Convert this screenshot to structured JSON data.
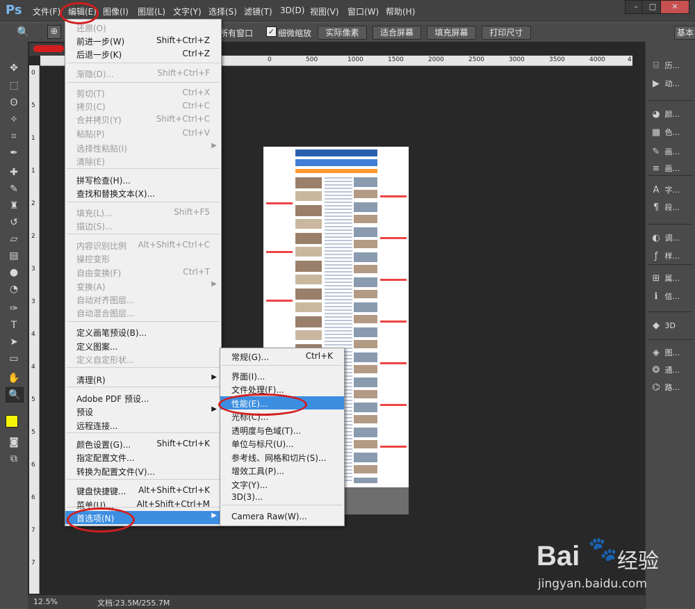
{
  "app": {
    "logo": "Ps"
  },
  "menubar": [
    {
      "label": "文件(F)"
    },
    {
      "label": "编辑(E)"
    },
    {
      "label": "图像(I)"
    },
    {
      "label": "图层(L)"
    },
    {
      "label": "文字(Y)"
    },
    {
      "label": "选择(S)"
    },
    {
      "label": "滤镜(T)"
    },
    {
      "label": "3D(D)"
    },
    {
      "label": "视图(V)"
    },
    {
      "label": "窗口(W)"
    },
    {
      "label": "帮助(H)"
    }
  ],
  "window": {
    "minimize": "–",
    "maximize": "□",
    "close": "✕"
  },
  "options": {
    "all_windows": "所有窗口",
    "scrubby": "细微缩放",
    "actual_pixels": "实际像素",
    "fit_screen": "适合屏幕",
    "fill_screen": "填充屏幕",
    "print_size": "打印尺寸",
    "workspace": "基本",
    "check": "✓"
  },
  "ruler": {
    "h": [
      "0",
      "500",
      "1000",
      "1500",
      "2000",
      "2500",
      "3000",
      "3500",
      "4000",
      "4"
    ],
    "v": [
      "0",
      "5",
      "1",
      "1",
      "2",
      "2",
      "3",
      "3",
      "4",
      "4",
      "5",
      "5",
      "6",
      "6",
      "7",
      "7"
    ]
  },
  "status": {
    "zoom": "12.5%",
    "doc": "文档:23.5M/255.7M"
  },
  "panels": [
    {
      "icon": "history-icon",
      "glyph": "⌸",
      "label": "历..."
    },
    {
      "icon": "actions-icon",
      "glyph": "▶",
      "label": "动..."
    },
    {
      "icon": "color-icon",
      "glyph": "◕",
      "label": "颜..."
    },
    {
      "icon": "swatches-icon",
      "glyph": "▦",
      "label": "色..."
    },
    {
      "icon": "brush-icon",
      "glyph": "✎",
      "label": "画..."
    },
    {
      "icon": "brush-presets-icon",
      "glyph": "≡",
      "label": "画..."
    },
    {
      "icon": "character-icon",
      "glyph": "A",
      "label": "字..."
    },
    {
      "icon": "paragraph-icon",
      "glyph": "¶",
      "label": "段..."
    },
    {
      "icon": "adjustments-icon",
      "glyph": "◐",
      "label": "调..."
    },
    {
      "icon": "styles-icon",
      "glyph": "ƒ",
      "label": "样..."
    },
    {
      "icon": "properties-icon",
      "glyph": "⊞",
      "label": "属..."
    },
    {
      "icon": "info-icon",
      "glyph": "ℹ",
      "label": "信..."
    },
    {
      "icon": "3d-icon",
      "glyph": "◆",
      "label": "3D"
    },
    {
      "icon": "layers-icon",
      "glyph": "◈",
      "label": "图..."
    },
    {
      "icon": "channels-icon",
      "glyph": "❂",
      "label": "通..."
    },
    {
      "icon": "paths-icon",
      "glyph": "⌬",
      "label": "路..."
    }
  ],
  "edit_menu": {
    "items": [
      {
        "label": "还原(O)",
        "shortcut": "",
        "disabled": true
      },
      {
        "label": "前进一步(W)",
        "shortcut": "Shift+Ctrl+Z",
        "disabled": false
      },
      {
        "label": "后退一步(K)",
        "shortcut": "Ctrl+Z",
        "disabled": false
      },
      {
        "label": "渐隐(D)...",
        "shortcut": "Shift+Ctrl+F",
        "disabled": true
      },
      {
        "label": "剪切(T)",
        "shortcut": "Ctrl+X",
        "disabled": true
      },
      {
        "label": "拷贝(C)",
        "shortcut": "Ctrl+C",
        "disabled": true
      },
      {
        "label": "合并拷贝(Y)",
        "shortcut": "Shift+Ctrl+C",
        "disabled": true
      },
      {
        "label": "粘贴(P)",
        "shortcut": "Ctrl+V",
        "disabled": true
      },
      {
        "label": "选择性粘贴(I)",
        "shortcut": "",
        "disabled": true
      },
      {
        "label": "清除(E)",
        "shortcut": "",
        "disabled": true
      },
      {
        "label": "拼写检查(H)...",
        "shortcut": "",
        "disabled": false
      },
      {
        "label": "查找和替换文本(X)...",
        "shortcut": "",
        "disabled": false
      },
      {
        "label": "填充(L)...",
        "shortcut": "Shift+F5",
        "disabled": true
      },
      {
        "label": "描边(S)...",
        "shortcut": "",
        "disabled": true
      },
      {
        "label": "内容识别比例",
        "shortcut": "Alt+Shift+Ctrl+C",
        "disabled": true
      },
      {
        "label": "操控变形",
        "shortcut": "",
        "disabled": true
      },
      {
        "label": "自由变换(F)",
        "shortcut": "Ctrl+T",
        "disabled": true
      },
      {
        "label": "变换(A)",
        "shortcut": "",
        "disabled": true
      },
      {
        "label": "自动对齐图层...",
        "shortcut": "",
        "disabled": true
      },
      {
        "label": "自动混合图层...",
        "shortcut": "",
        "disabled": true
      },
      {
        "label": "定义画笔预设(B)...",
        "shortcut": "",
        "disabled": false
      },
      {
        "label": "定义图案...",
        "shortcut": "",
        "disabled": false
      },
      {
        "label": "定义自定形状...",
        "shortcut": "",
        "disabled": true
      },
      {
        "label": "清理(R)",
        "shortcut": "",
        "disabled": false
      },
      {
        "label": "Adobe PDF 预设...",
        "shortcut": "",
        "disabled": false
      },
      {
        "label": "预设",
        "shortcut": "",
        "disabled": false
      },
      {
        "label": "远程连接...",
        "shortcut": "",
        "disabled": false
      },
      {
        "label": "颜色设置(G)...",
        "shortcut": "Shift+Ctrl+K",
        "disabled": false
      },
      {
        "label": "指定配置文件...",
        "shortcut": "",
        "disabled": false
      },
      {
        "label": "转换为配置文件(V)...",
        "shortcut": "",
        "disabled": false
      },
      {
        "label": "键盘快捷键...",
        "shortcut": "Alt+Shift+Ctrl+K",
        "disabled": false
      },
      {
        "label": "菜单(U)...",
        "shortcut": "Alt+Shift+Ctrl+M",
        "disabled": false
      },
      {
        "label": "首选项(N)",
        "shortcut": "",
        "disabled": false
      }
    ]
  },
  "prefs_menu": {
    "items": [
      {
        "label": "常规(G)...",
        "shortcut": "Ctrl+K"
      },
      {
        "label": "界面(I)...",
        "shortcut": ""
      },
      {
        "label": "文件处理(F)...",
        "shortcut": ""
      },
      {
        "label": "性能(E)...",
        "shortcut": ""
      },
      {
        "label": "光标(C)...",
        "shortcut": ""
      },
      {
        "label": "透明度与色域(T)...",
        "shortcut": ""
      },
      {
        "label": "单位与标尺(U)...",
        "shortcut": ""
      },
      {
        "label": "参考线、网格和切片(S)...",
        "shortcut": ""
      },
      {
        "label": "增效工具(P)...",
        "shortcut": ""
      },
      {
        "label": "文字(Y)...",
        "shortcut": ""
      },
      {
        "label": "3D(3)...",
        "shortcut": ""
      },
      {
        "label": "Camera Raw(W)...",
        "shortcut": ""
      }
    ]
  },
  "submenu_arrow": "▶",
  "watermark": {
    "brand": "Bai",
    "brand2": "经验",
    "url": "jingyan.baidu.com"
  },
  "colors": {
    "accent": "#3c8ee0",
    "annotation": "#d21e1e",
    "foreground": "#f5f50a",
    "background": "#ffffff"
  }
}
